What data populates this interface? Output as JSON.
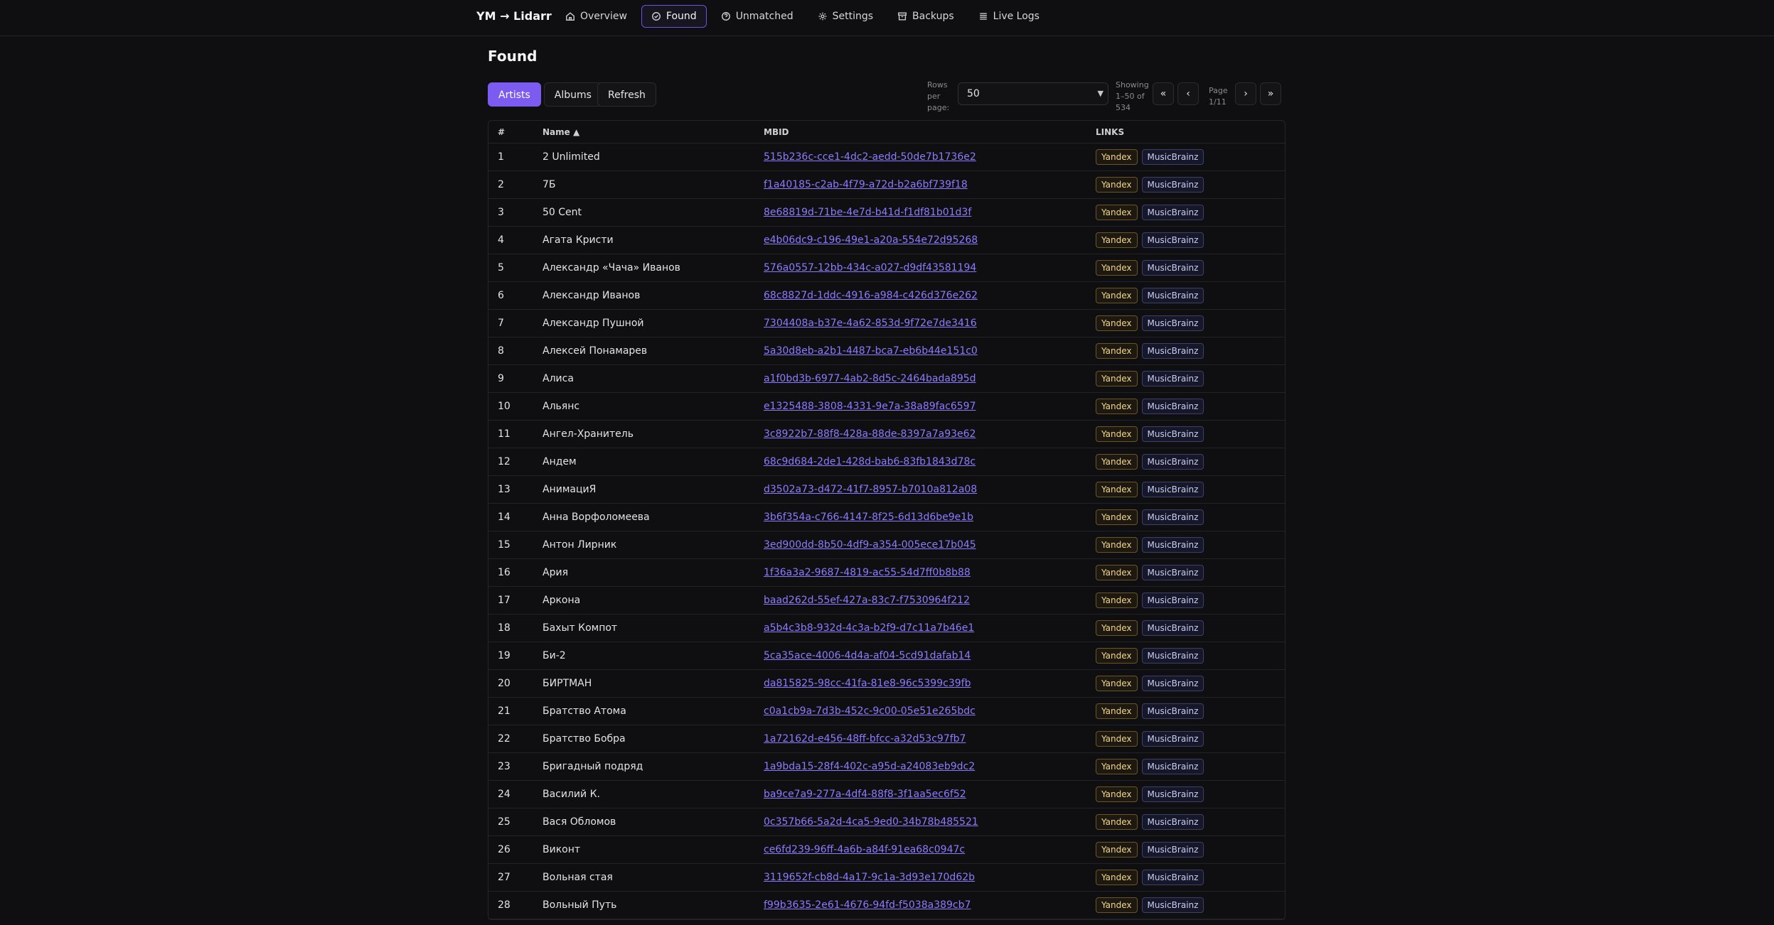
{
  "app": {
    "brand": "YM → Lidarr"
  },
  "nav": [
    {
      "label": "Overview",
      "icon": "home-icon",
      "active": false
    },
    {
      "label": "Found",
      "icon": "check-circle-icon",
      "active": true
    },
    {
      "label": "Unmatched",
      "icon": "question-circle-icon",
      "active": false
    },
    {
      "label": "Settings",
      "icon": "gear-icon",
      "active": false
    },
    {
      "label": "Backups",
      "icon": "archive-icon",
      "active": false
    },
    {
      "label": "Live Logs",
      "icon": "list-icon",
      "active": false
    }
  ],
  "page": {
    "title": "Found"
  },
  "tabs": {
    "artists": "Artists",
    "albums": "Albums",
    "active": "Artists"
  },
  "refresh_label": "Refresh",
  "pagination": {
    "rows_per_page_label": "Rows per page:",
    "rows_per_page_value": "50",
    "showing": "Showing 1–50 of 534",
    "page": "Page 1/11",
    "first": "«",
    "prev": "‹",
    "next": "›",
    "last": "»"
  },
  "table": {
    "headers": {
      "num": "#",
      "name": "Name ▲",
      "mbid": "MBID",
      "links": "LINKS"
    },
    "link_labels": {
      "yandex": "Yandex",
      "musicbrainz": "MusicBrainz"
    },
    "rows": [
      {
        "num": "1",
        "name": "2 Unlimited",
        "mbid": "515b236c-cce1-4dc2-aedd-50de7b1736e2"
      },
      {
        "num": "2",
        "name": "7Б",
        "mbid": "f1a40185-c2ab-4f79-a72d-b2a6bf739f18"
      },
      {
        "num": "3",
        "name": "50 Cent",
        "mbid": "8e68819d-71be-4e7d-b41d-f1df81b01d3f"
      },
      {
        "num": "4",
        "name": "Агата Кристи",
        "mbid": "e4b06dc9-c196-49e1-a20a-554e72d95268"
      },
      {
        "num": "5",
        "name": "Александр «Чача» Иванов",
        "mbid": "576a0557-12bb-434c-a027-d9df43581194"
      },
      {
        "num": "6",
        "name": "Александр Иванов",
        "mbid": "68c8827d-1ddc-4916-a984-c426d376e262"
      },
      {
        "num": "7",
        "name": "Александр Пушной",
        "mbid": "7304408a-b37e-4a62-853d-9f72e7de3416"
      },
      {
        "num": "8",
        "name": "Алексей Понамарев",
        "mbid": "5a30d8eb-a2b1-4487-bca7-eb6b44e151c0"
      },
      {
        "num": "9",
        "name": "Алиса",
        "mbid": "a1f0bd3b-6977-4ab2-8d5c-2464bada895d"
      },
      {
        "num": "10",
        "name": "Альянс",
        "mbid": "e1325488-3808-4331-9e7a-38a89fac6597"
      },
      {
        "num": "11",
        "name": "Ангел-Хранитель",
        "mbid": "3c8922b7-88f8-428a-88de-8397a7a93e62"
      },
      {
        "num": "12",
        "name": "Андем",
        "mbid": "68c9d684-2de1-428d-bab6-83fb1843d78c"
      },
      {
        "num": "13",
        "name": "АнимациЯ",
        "mbid": "d3502a73-d472-41f7-8957-b7010a812a08"
      },
      {
        "num": "14",
        "name": "Анна Ворфоломеева",
        "mbid": "3b6f354a-c766-4147-8f25-6d13d6be9e1b"
      },
      {
        "num": "15",
        "name": "Антон Лирник",
        "mbid": "3ed900dd-8b50-4df9-a354-005ece17b045"
      },
      {
        "num": "16",
        "name": "Ария",
        "mbid": "1f36a3a2-9687-4819-ac55-54d7ff0b8b88"
      },
      {
        "num": "17",
        "name": "Аркона",
        "mbid": "baad262d-55ef-427a-83c7-f7530964f212"
      },
      {
        "num": "18",
        "name": "Бахыт Компот",
        "mbid": "a5b4c3b8-932d-4c3a-b2f9-d7c11a7b46e1"
      },
      {
        "num": "19",
        "name": "Би-2",
        "mbid": "5ca35ace-4006-4d4a-af04-5cd91dafab14"
      },
      {
        "num": "20",
        "name": "БИРТМАН",
        "mbid": "da815825-98cc-41fa-81e8-96c5399c39fb"
      },
      {
        "num": "21",
        "name": "Братство Атома",
        "mbid": "c0a1cb9a-7d3b-452c-9c00-05e51e265bdc"
      },
      {
        "num": "22",
        "name": "Братство Бобра",
        "mbid": "1a72162d-e456-48ff-bfcc-a32d53c97fb7"
      },
      {
        "num": "23",
        "name": "Бригадный подряд",
        "mbid": "1a9bda15-28f4-402c-a95d-a24083eb9dc2"
      },
      {
        "num": "24",
        "name": "Василий К.",
        "mbid": "ba9ce7a9-277a-4df4-88f8-3f1aa5ec6f52"
      },
      {
        "num": "25",
        "name": "Вася Обломов",
        "mbid": "0c357b66-5a2d-4ca5-9ed0-34b78b485521"
      },
      {
        "num": "26",
        "name": "Виконт",
        "mbid": "ce6fd239-96ff-4a6b-a84f-91ea68c0947c"
      },
      {
        "num": "27",
        "name": "Вольная стая",
        "mbid": "3119652f-cb8d-4a17-9c1a-3d93e170d62b"
      },
      {
        "num": "28",
        "name": "Вольный Путь",
        "mbid": "f99b3635-2e61-4676-94fd-f5038a389cb7"
      }
    ]
  }
}
